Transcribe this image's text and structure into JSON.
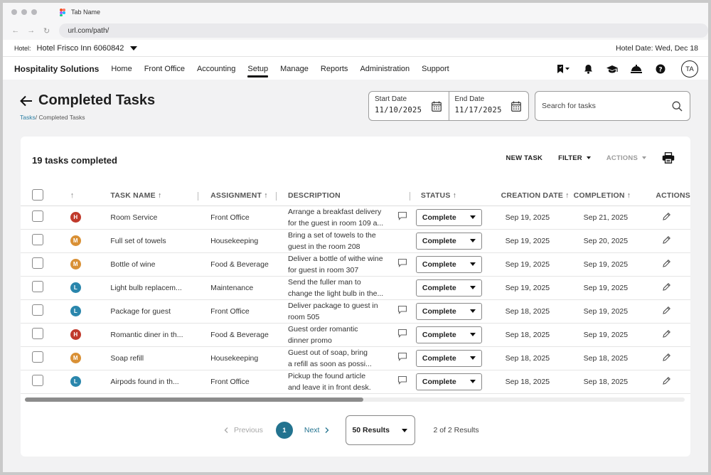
{
  "browser": {
    "tab_title": "Tab Name",
    "url": "url.com/path/"
  },
  "hotelbar": {
    "label": "Hotel:",
    "hotel_name": "Hotel Frisco Inn 6060842",
    "hotel_date": "Hotel Date: Wed, Dec 18"
  },
  "nav": {
    "brand": "Hospitality Solutions",
    "items": [
      {
        "label": "Home",
        "active": false
      },
      {
        "label": "Front Office",
        "active": false
      },
      {
        "label": "Accounting",
        "active": false
      },
      {
        "label": "Setup",
        "active": true
      },
      {
        "label": "Manage",
        "active": false
      },
      {
        "label": "Reports",
        "active": false
      },
      {
        "label": "Administration",
        "active": false
      },
      {
        "label": "Support",
        "active": false
      }
    ],
    "icons": [
      "bookmark-menu-icon",
      "bell-icon",
      "graduation-cap-icon",
      "service-bell-icon",
      "help-icon"
    ],
    "avatar_initials": "TA"
  },
  "page": {
    "title": "Completed Tasks",
    "breadcrumb_link": "Tasks",
    "breadcrumb_current": "/ Completed Tasks",
    "start_date_label": "Start Date",
    "start_date_value": "11/10/2025",
    "end_date_label": "End Date",
    "end_date_value": "11/17/2025",
    "search_placeholder": "Search for tasks"
  },
  "card": {
    "heading": "19 tasks completed",
    "new_task_label": "NEW TASK",
    "filter_label": "FILTER",
    "actions_label": "ACTIONS"
  },
  "table": {
    "columns": {
      "sort": "↑",
      "task_name": "TASK NAME ↑",
      "assignment": "ASSIGNMENT ↑",
      "description": "DESCRIPTION",
      "status": "STATUS ↑",
      "creation_date": "CREATION DATE ↑",
      "completion": "COMPLETION ↑",
      "actions": "ACTIONS"
    },
    "priority_colors": {
      "H": "#c0392b",
      "M": "#d99035",
      "L": "#2a86ac"
    },
    "rows": [
      {
        "priority": "H",
        "task_name": "Room Service",
        "assignment": "Front Office",
        "description_1": "Arrange a breakfast delivery",
        "description_2": "for the guest in room 109 a...",
        "has_comment": true,
        "status": "Complete",
        "creation_date": "Sep 19, 2025",
        "completion": "Sep 21, 2025"
      },
      {
        "priority": "M",
        "task_name": "Full set of towels",
        "assignment": "Housekeeping",
        "description_1": "Bring a set of towels to the",
        "description_2": "guest in the room 208",
        "has_comment": false,
        "status": "Complete",
        "creation_date": "Sep 19, 2025",
        "completion": "Sep 20, 2025"
      },
      {
        "priority": "M",
        "task_name": "Bottle of wine",
        "assignment": "Food & Beverage",
        "description_1": "Deliver a bottle of withe wine",
        "description_2": "for guest in room 307",
        "has_comment": true,
        "status": "Complete",
        "creation_date": "Sep 19, 2025",
        "completion": "Sep 19, 2025"
      },
      {
        "priority": "L",
        "task_name": "Light bulb replacem...",
        "assignment": "Maintenance",
        "description_1": "Send the fuller man to",
        "description_2": "change the light bulb in the...",
        "has_comment": false,
        "status": "Complete",
        "creation_date": "Sep 19, 2025",
        "completion": "Sep 19, 2025"
      },
      {
        "priority": "L",
        "task_name": "Package for guest",
        "assignment": "Front Office",
        "description_1": "Deliver package to guest in",
        "description_2": "room 505",
        "has_comment": true,
        "status": "Complete",
        "creation_date": "Sep 18, 2025",
        "completion": "Sep 19, 2025"
      },
      {
        "priority": "H",
        "task_name": "Romantic diner in th...",
        "assignment": "Food & Beverage",
        "description_1": "Guest order romantic",
        "description_2": "dinner promo",
        "has_comment": true,
        "status": "Complete",
        "creation_date": "Sep 18, 2025",
        "completion": "Sep 19, 2025"
      },
      {
        "priority": "M",
        "task_name": "Soap refill",
        "assignment": "Housekeeping",
        "description_1": "Guest out of soap, bring",
        "description_2": "a refill as soon as possi...",
        "has_comment": true,
        "status": "Complete",
        "creation_date": "Sep 18, 2025",
        "completion": "Sep 18, 2025"
      },
      {
        "priority": "L",
        "task_name": "Airpods found in th...",
        "assignment": "Front Office",
        "description_1": "Pickup the found article",
        "description_2": "and leave it in front desk.",
        "has_comment": true,
        "status": "Complete",
        "creation_date": "Sep 18, 2025",
        "completion": "Sep 18, 2025"
      }
    ]
  },
  "pagination": {
    "previous": "Previous",
    "current_page": "1",
    "next": "Next",
    "page_size": "50 Results",
    "summary": "2 of 2 Results"
  }
}
